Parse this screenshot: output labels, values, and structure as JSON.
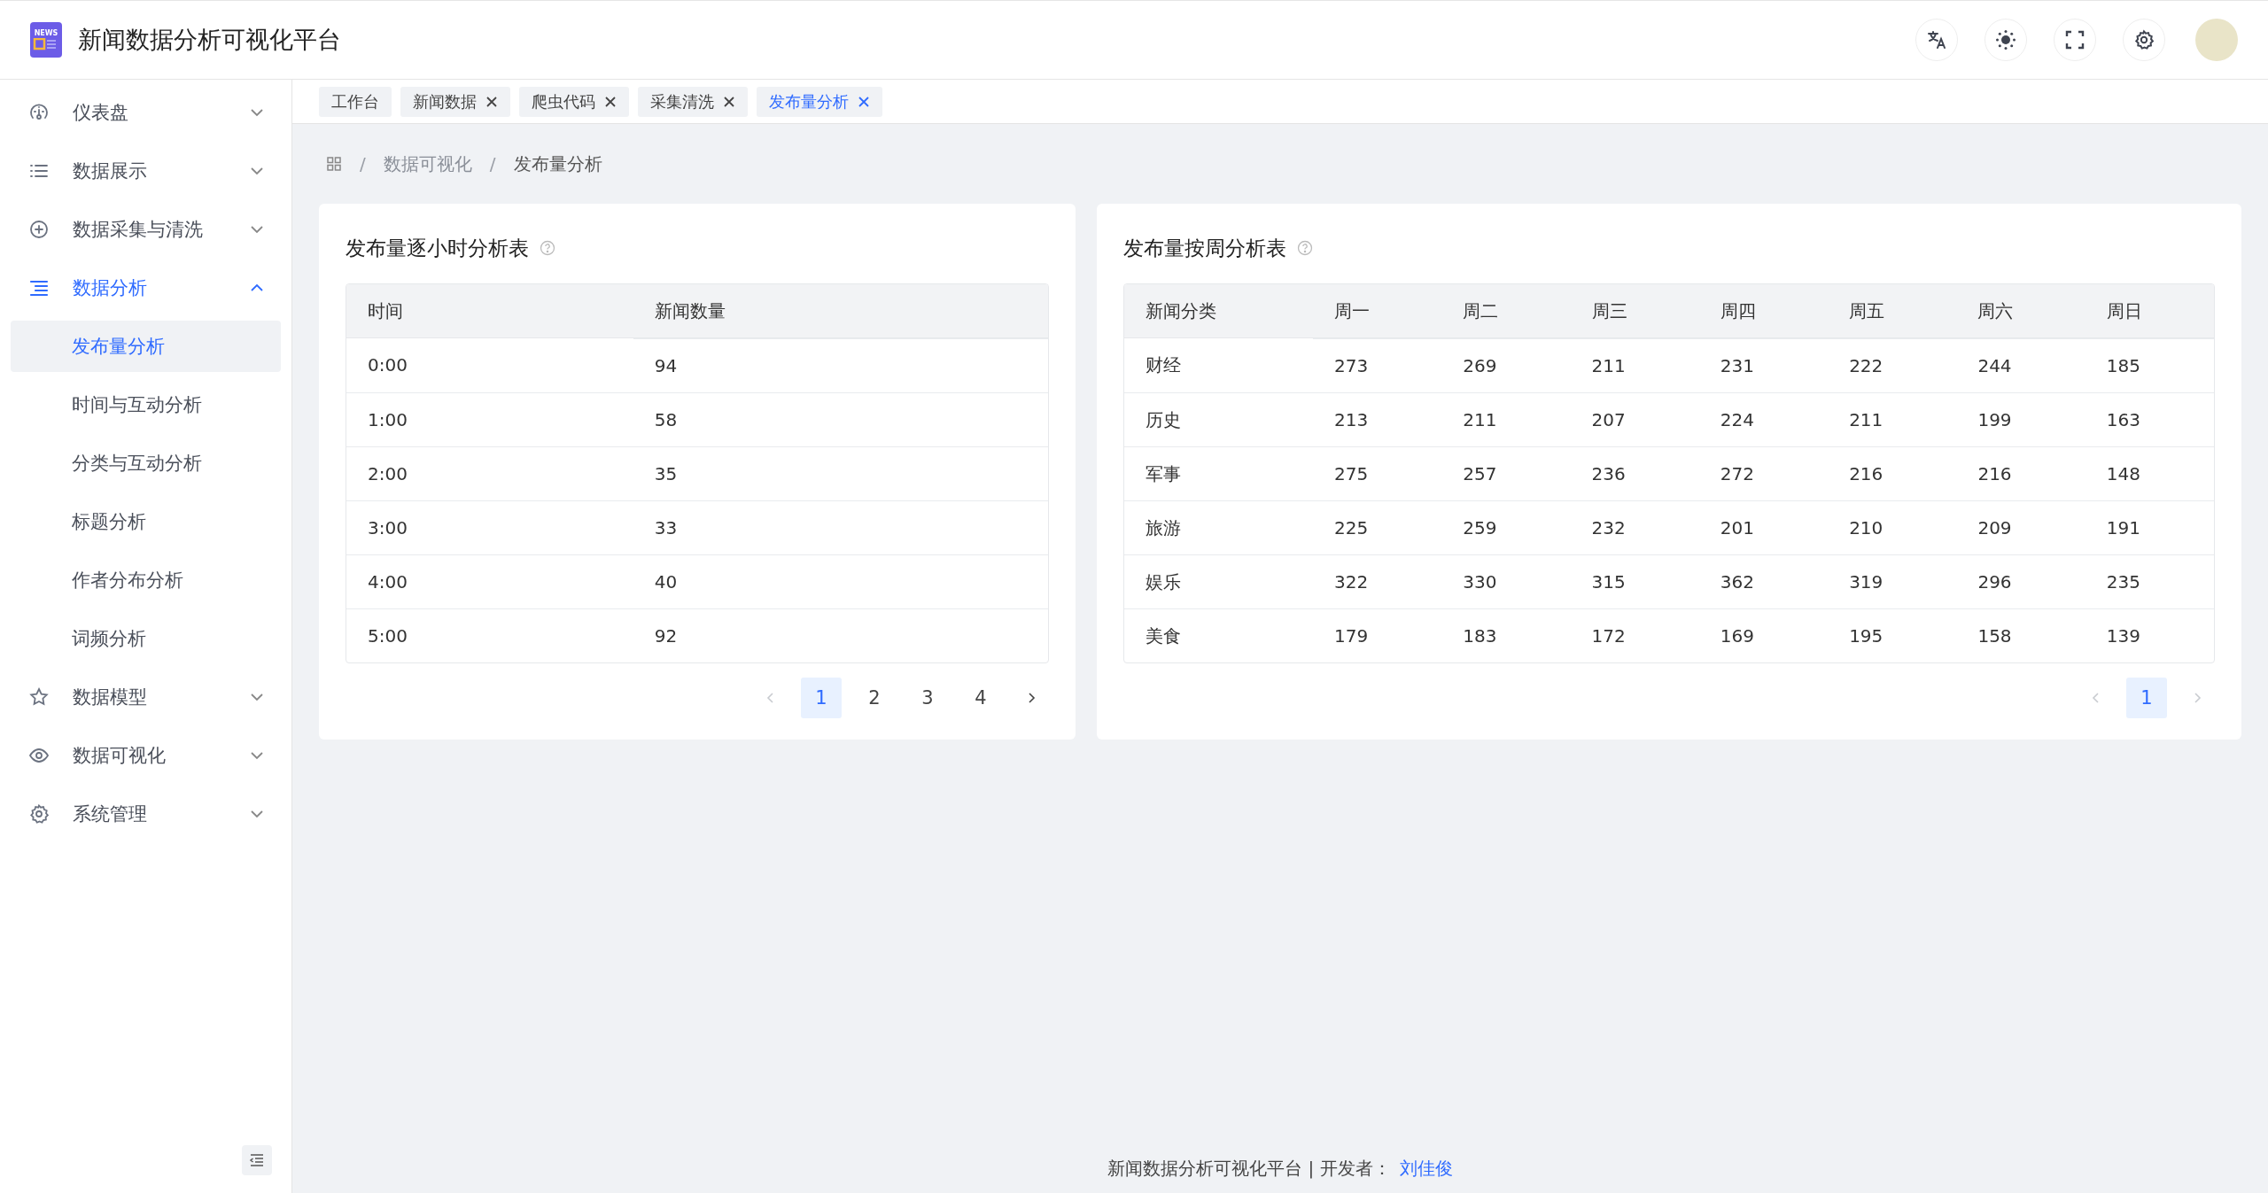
{
  "header": {
    "title": "新闻数据分析可视化平台",
    "logo_text": "NEWS"
  },
  "sidebar": {
    "items": [
      {
        "label": "仪表盘",
        "expanded": false
      },
      {
        "label": "数据展示",
        "expanded": false
      },
      {
        "label": "数据采集与清洗",
        "expanded": false
      },
      {
        "label": "数据分析",
        "expanded": true,
        "children": [
          {
            "label": "发布量分析",
            "selected": true
          },
          {
            "label": "时间与互动分析",
            "selected": false
          },
          {
            "label": "分类与互动分析",
            "selected": false
          },
          {
            "label": "标题分析",
            "selected": false
          },
          {
            "label": "作者分布分析",
            "selected": false
          },
          {
            "label": "词频分析",
            "selected": false
          }
        ]
      },
      {
        "label": "数据模型",
        "expanded": false
      },
      {
        "label": "数据可视化",
        "expanded": false
      },
      {
        "label": "系统管理",
        "expanded": false
      }
    ]
  },
  "tabs": [
    {
      "label": "工作台",
      "selected": false,
      "closable": false
    },
    {
      "label": "新闻数据",
      "selected": false,
      "closable": true
    },
    {
      "label": "爬虫代码",
      "selected": false,
      "closable": true
    },
    {
      "label": "采集清洗",
      "selected": false,
      "closable": true
    },
    {
      "label": "发布量分析",
      "selected": true,
      "closable": true
    }
  ],
  "breadcrumb": {
    "separator": "/",
    "items": [
      "数据可视化",
      "发布量分析"
    ]
  },
  "cards": [
    {
      "title": "发布量逐小时分析表",
      "columns": [
        "时间",
        "新闻数量"
      ],
      "rows": [
        [
          "0:00",
          "94"
        ],
        [
          "1:00",
          "58"
        ],
        [
          "2:00",
          "35"
        ],
        [
          "3:00",
          "33"
        ],
        [
          "4:00",
          "40"
        ],
        [
          "5:00",
          "92"
        ]
      ],
      "pagination": {
        "prev_disabled": true,
        "next_disabled": false,
        "pages": [
          {
            "label": "1",
            "selected": true
          },
          {
            "label": "2",
            "selected": false
          },
          {
            "label": "3",
            "selected": false
          },
          {
            "label": "4",
            "selected": false
          }
        ]
      }
    },
    {
      "title": "发布量按周分析表",
      "columns": [
        "新闻分类",
        "周一",
        "周二",
        "周三",
        "周四",
        "周五",
        "周六",
        "周日"
      ],
      "rows": [
        [
          "财经",
          "273",
          "269",
          "211",
          "231",
          "222",
          "244",
          "185"
        ],
        [
          "历史",
          "213",
          "211",
          "207",
          "224",
          "211",
          "199",
          "163"
        ],
        [
          "军事",
          "275",
          "257",
          "236",
          "272",
          "216",
          "216",
          "148"
        ],
        [
          "旅游",
          "225",
          "259",
          "232",
          "201",
          "210",
          "209",
          "191"
        ],
        [
          "娱乐",
          "322",
          "330",
          "315",
          "362",
          "319",
          "296",
          "235"
        ],
        [
          "美食",
          "179",
          "183",
          "172",
          "169",
          "195",
          "158",
          "139"
        ]
      ],
      "pagination": {
        "prev_disabled": true,
        "next_disabled": true,
        "pages": [
          {
            "label": "1",
            "selected": true
          }
        ]
      }
    }
  ],
  "footer": {
    "text": "新闻数据分析可视化平台 | 开发者：",
    "author": "刘佳俊"
  }
}
